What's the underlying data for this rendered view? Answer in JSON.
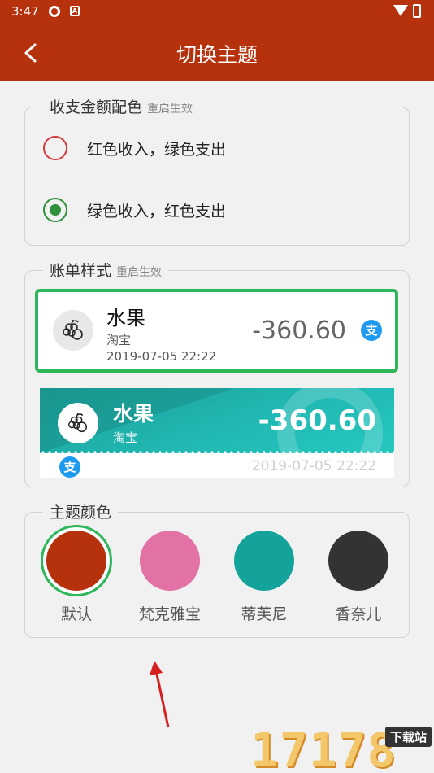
{
  "status_bar": {
    "time": "3:47"
  },
  "header": {
    "title": "切换主题"
  },
  "amount_color": {
    "title": "收支金额配色",
    "hint": "重启生效",
    "options": [
      {
        "label": "红色收入，绿色支出",
        "checked": false
      },
      {
        "label": "绿色收入，红色支出",
        "checked": true
      }
    ]
  },
  "bill_style": {
    "title": "账单样式",
    "hint": "重启生效",
    "card1": {
      "category": "水果",
      "source": "淘宝",
      "date": "2019-07-05 22:22",
      "amount": "-360.60",
      "pay_icon": "支"
    },
    "card2": {
      "category": "水果",
      "source": "淘宝",
      "date": "2019-07-05 22:22",
      "amount": "-360.60",
      "pay_icon": "支"
    }
  },
  "theme_color": {
    "title": "主题颜色",
    "options": [
      {
        "label": "默认",
        "color": "#b5320d",
        "selected": true
      },
      {
        "label": "梵克雅宝",
        "color": "#e272a6",
        "selected": false
      },
      {
        "label": "蒂芙尼",
        "color": "#13a39b",
        "selected": false
      },
      {
        "label": "香奈儿",
        "color": "#333333",
        "selected": false
      }
    ]
  },
  "watermark": {
    "text": "17178",
    "tag": "下载站"
  }
}
